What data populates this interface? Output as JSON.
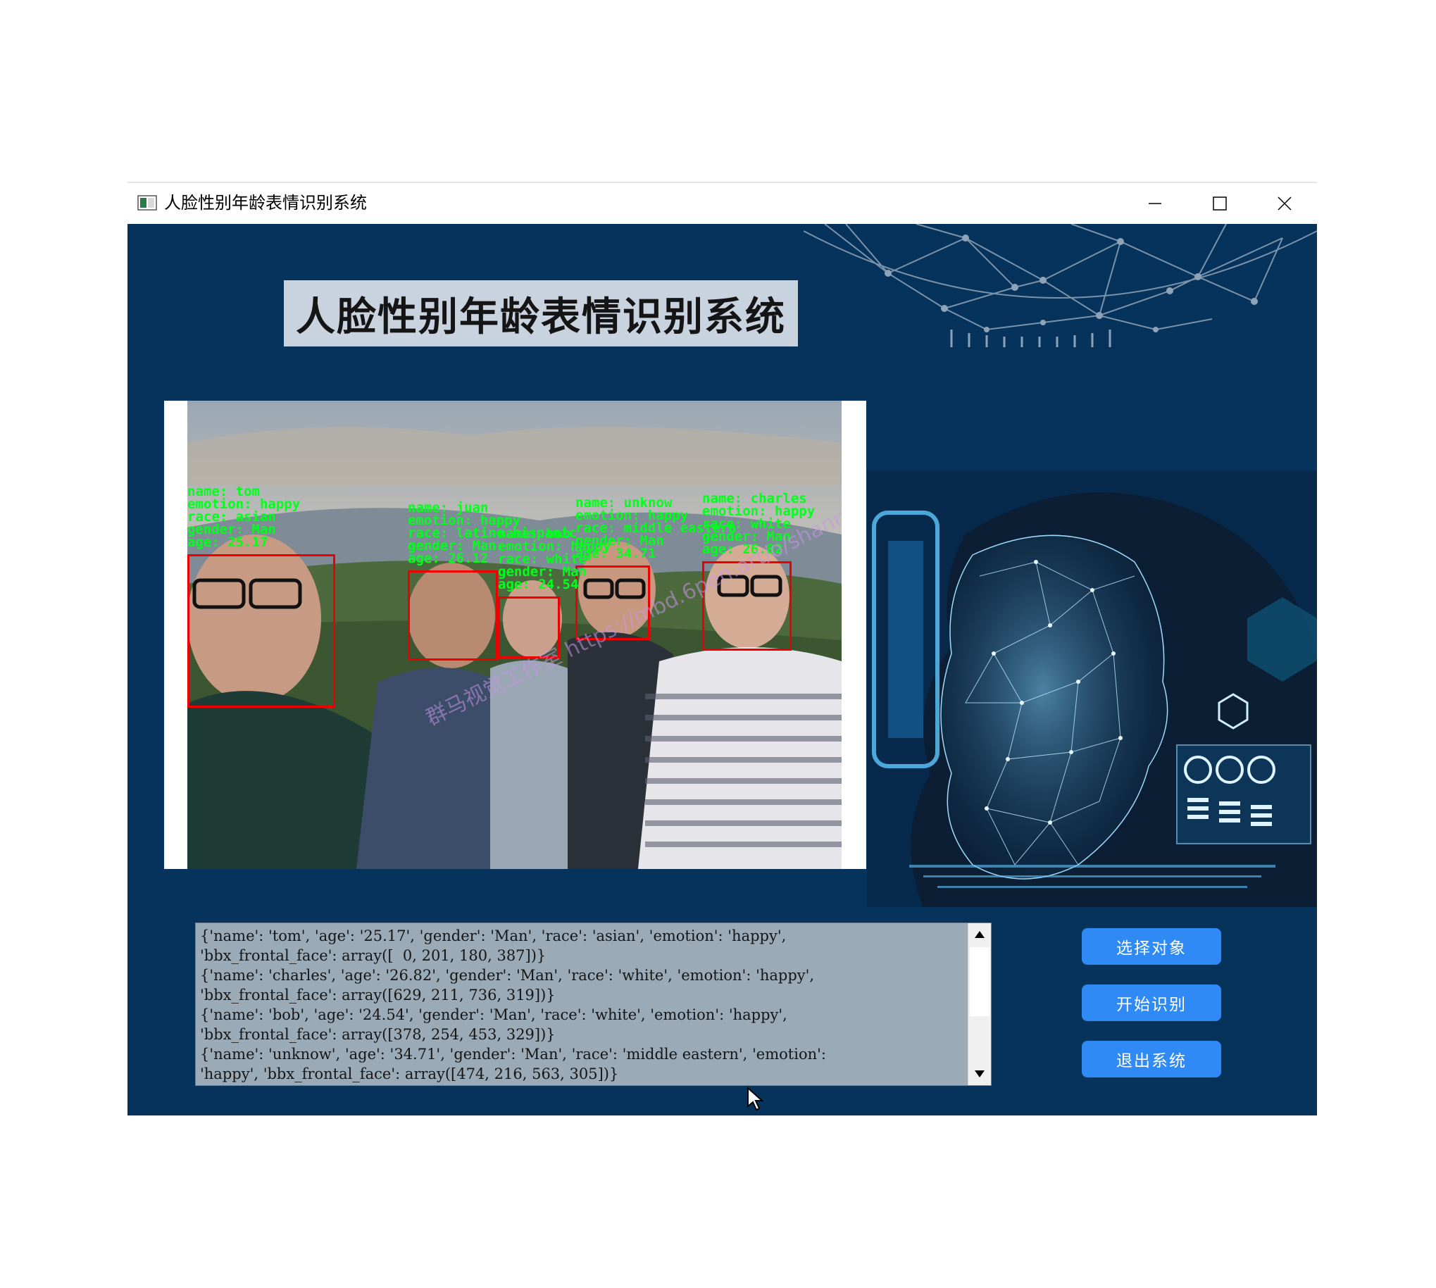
{
  "window": {
    "title": "人脸性别年龄表情识别系统",
    "controls": {
      "minimize": "minimize-icon",
      "maximize": "maximize-icon",
      "close": "close-icon"
    }
  },
  "banner": {
    "title": "人脸性别年龄表情识别系统"
  },
  "detections": [
    {
      "label": "name: tom\nemotion: happy\nrace: asian\ngender: Man\nage: 25.17"
    },
    {
      "label": "name: juan\nemotion: happy\nrace: latino hispanic\ngender: Man\nage: 26.12"
    },
    {
      "label": "name: bob\nemotion: happy\nrace: white\ngender: Man\nage: 24.54"
    },
    {
      "label": "name: unknow\nemotion: happy\nrace: middle eastern\ngender: Man\nage: 34.71"
    },
    {
      "label": "name: charles\nemotion: happy\nrace: white\ngender: Man\nage: 26.82"
    }
  ],
  "watermark": "群马视觉工作室 https://mbd.6pen.art/o/shanma.work",
  "log": {
    "lines": [
      "{'name': 'tom', 'age': '25.17', 'gender': 'Man', 'race': 'asian', 'emotion': 'happy',",
      "'bbx_frontal_face': array([  0, 201, 180, 387])}",
      "{'name': 'charles', 'age': '26.82', 'gender': 'Man', 'race': 'white', 'emotion': 'happy',",
      "'bbx_frontal_face': array([629, 211, 736, 319])}",
      "{'name': 'bob', 'age': '24.54', 'gender': 'Man', 'race': 'white', 'emotion': 'happy',",
      "'bbx_frontal_face': array([378, 254, 453, 329])}",
      "{'name': 'unknow', 'age': '34.71', 'gender': 'Man', 'race': 'middle eastern', 'emotion':",
      "'happy', 'bbx_frontal_face': array([474, 216, 563, 305])}"
    ]
  },
  "buttons": {
    "select": "选择对象",
    "start": "开始识别",
    "exit": "退出系统"
  },
  "colors": {
    "background": "#06335b",
    "button": "#2f8af5",
    "banner": "#c9d3df",
    "detection_box": "#e00000",
    "detection_text": "#00ff1a",
    "log_bg": "#9aaab6"
  }
}
